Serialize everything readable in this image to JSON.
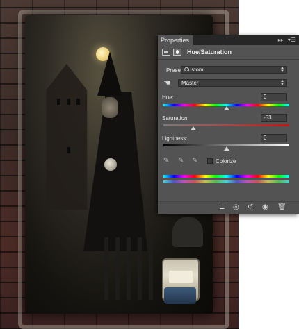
{
  "panel": {
    "tab_label": "Properties",
    "collapse_glyph": "▸▸",
    "menu_glyph": "▾☰",
    "title": "Hue/Saturation",
    "preset_label": "Preset:",
    "preset_value": "Custom",
    "channel_value": "Master",
    "hue_label": "Hue:",
    "hue_value": "0",
    "hue_fraction": 0.5,
    "saturation_label": "Saturation:",
    "saturation_value": "-53",
    "saturation_fraction": 0.24,
    "lightness_label": "Lightness:",
    "lightness_value": "0",
    "lightness_fraction": 0.5,
    "colorize_label": "Colorize",
    "colorize_checked": false,
    "icons": [
      "adjustment-layer-icon",
      "layer-mask-icon",
      "targeted-adjustment-hand-icon",
      "eyedropper-icon",
      "eyedropper-plus-icon",
      "eyedropper-minus-icon",
      "clip-to-layer-icon",
      "view-previous-state-icon",
      "reset-icon",
      "toggle-visibility-icon",
      "delete-adjustment-icon"
    ]
  },
  "colors": {
    "panel_bg": "#535353",
    "header_bg": "#262626",
    "field_bg": "#424242",
    "text": "#e6e6e6"
  }
}
